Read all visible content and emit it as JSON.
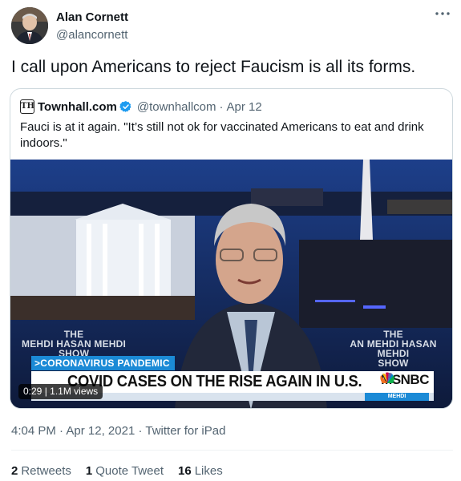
{
  "author": {
    "name": "Alan Cornett",
    "handle": "@alancornett",
    "avatar_icon": "profile-photo"
  },
  "more_icon": "more-horizontal-icon",
  "tweet": {
    "text": "I call upon Americans to reject Faucism is all its forms."
  },
  "quoted_tweet": {
    "logo_text": "TH",
    "name": "Townhall.com",
    "verified_icon": "verified-badge-icon",
    "handle": "@townhallcom",
    "separator": "·",
    "date": "Apr 12",
    "text": "Fauci is at it again. \"It’s still not ok for vaccinated Americans to eat and drink indoors.\"",
    "video": {
      "tag": ">CORONAVIRUS PANDEMIC",
      "headline": "COVID CASES ON THE RISE AGAIN IN U.S.",
      "network": "MSNBC",
      "ticker": "MEHDI",
      "show_logo_left": [
        "THE",
        "MEHDI HASAN  MEHDI",
        "SHOW"
      ],
      "show_logo_right": [
        "THE",
        "AN  MEHDI HASAN  MEHDI",
        "SHOW"
      ],
      "elapsed": "0:29",
      "views": "1.1M views",
      "brand_blue": "#1b8ad6"
    }
  },
  "meta": {
    "time": "4:04 PM",
    "sep1": "·",
    "date": "Apr 12, 2021",
    "sep2": "·",
    "source": "Twitter for iPad"
  },
  "stats": {
    "retweets_count": "2",
    "retweets_label": "Retweets",
    "quotes_count": "1",
    "quotes_label": "Quote Tweet",
    "likes_count": "16",
    "likes_label": "Likes"
  }
}
